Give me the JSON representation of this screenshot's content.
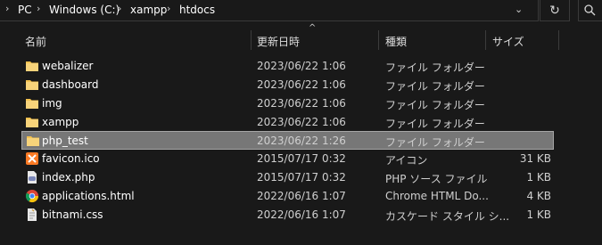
{
  "address_bar": {
    "path": [
      "PC",
      "Windows (C:)",
      "xampp",
      "htdocs"
    ],
    "dropdown_icon": "chevron-down-icon",
    "refresh_icon": "refresh-icon",
    "search_icon": "search-icon"
  },
  "columns": {
    "name": "名前",
    "date": "更新日時",
    "type": "種類",
    "size": "サイズ"
  },
  "files": [
    {
      "name": "webalizer",
      "date": "2023/06/22 1:06",
      "type": "ファイル フォルダー",
      "size": "",
      "icon": "folder-icon"
    },
    {
      "name": "dashboard",
      "date": "2023/06/22 1:06",
      "type": "ファイル フォルダー",
      "size": "",
      "icon": "folder-icon"
    },
    {
      "name": "img",
      "date": "2023/06/22 1:06",
      "type": "ファイル フォルダー",
      "size": "",
      "icon": "folder-icon"
    },
    {
      "name": "xampp",
      "date": "2023/06/22 1:06",
      "type": "ファイル フォルダー",
      "size": "",
      "icon": "folder-icon"
    },
    {
      "name": "php_test",
      "date": "2023/06/22 1:26",
      "type": "ファイル フォルダー",
      "size": "",
      "icon": "folder-icon",
      "selected": true
    },
    {
      "name": "favicon.ico",
      "date": "2015/07/17 0:32",
      "type": "アイコン",
      "size": "31 KB",
      "icon": "xampp-icon"
    },
    {
      "name": "index.php",
      "date": "2015/07/17 0:32",
      "type": "PHP ソース ファイル",
      "size": "1 KB",
      "icon": "php-file-icon"
    },
    {
      "name": "applications.html",
      "date": "2022/06/16 1:07",
      "type": "Chrome HTML Do...",
      "size": "4 KB",
      "icon": "chrome-icon"
    },
    {
      "name": "bitnami.css",
      "date": "2022/06/16 1:07",
      "type": "カスケード スタイル シ...",
      "size": "1 KB",
      "icon": "css-file-icon"
    }
  ],
  "colors": {
    "background": "#191919",
    "selected_row": "#777777",
    "folder": "#f2c14e"
  }
}
